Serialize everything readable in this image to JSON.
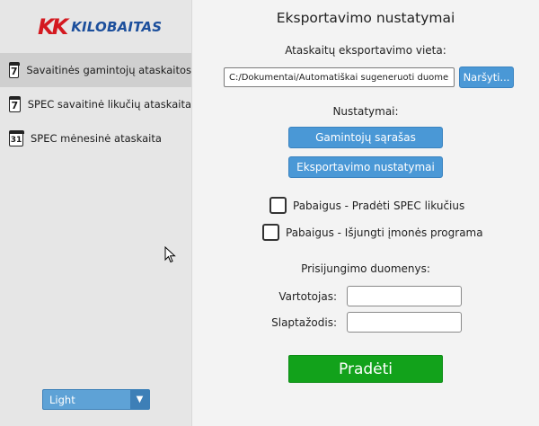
{
  "brand": {
    "mark": "KK",
    "name": "KILOBAITAS"
  },
  "sidebar": {
    "items": [
      {
        "label": "Savaitinės gamintojų ataskaitos",
        "icon_text": "7",
        "icon": "calendar-7-icon",
        "active": true
      },
      {
        "label": "SPEC savaitinė likučių ataskaita",
        "icon_text": "7",
        "icon": "calendar-7-icon",
        "active": false
      },
      {
        "label": "SPEC mėnesinė ataskaita",
        "icon_text": "31",
        "icon": "calendar-31-icon",
        "active": false
      }
    ],
    "theme": {
      "value": "Light"
    }
  },
  "main": {
    "title": "Eksportavimo nustatymai",
    "export_location_label": "Ataskaitų eksportavimo vieta:",
    "export_path": "C:/Dokumentai/Automatiškai sugeneruoti duomenys",
    "browse_label": "Naršyti...",
    "settings_label": "Nustatymai:",
    "manufacturers_button": "Gamintojų sąrašas",
    "export_settings_button": "Eksportavimo nustatymai",
    "checkbox_spec": {
      "label": "Pabaigus - Pradėti SPEC likučius",
      "checked": false
    },
    "checkbox_shutdown": {
      "label": "Pabaigus - Išjungti įmonės programa",
      "checked": false
    },
    "login_label": "Prisijungimo duomenys:",
    "username_label": "Vartotojas:",
    "username_value": "",
    "password_label": "Slaptažodis:",
    "password_value": "",
    "start_button": "Pradėti"
  },
  "colors": {
    "accent_blue": "#4a98d6",
    "start_green": "#12a21b",
    "brand_red": "#d41920",
    "brand_blue": "#1c4f9c"
  }
}
